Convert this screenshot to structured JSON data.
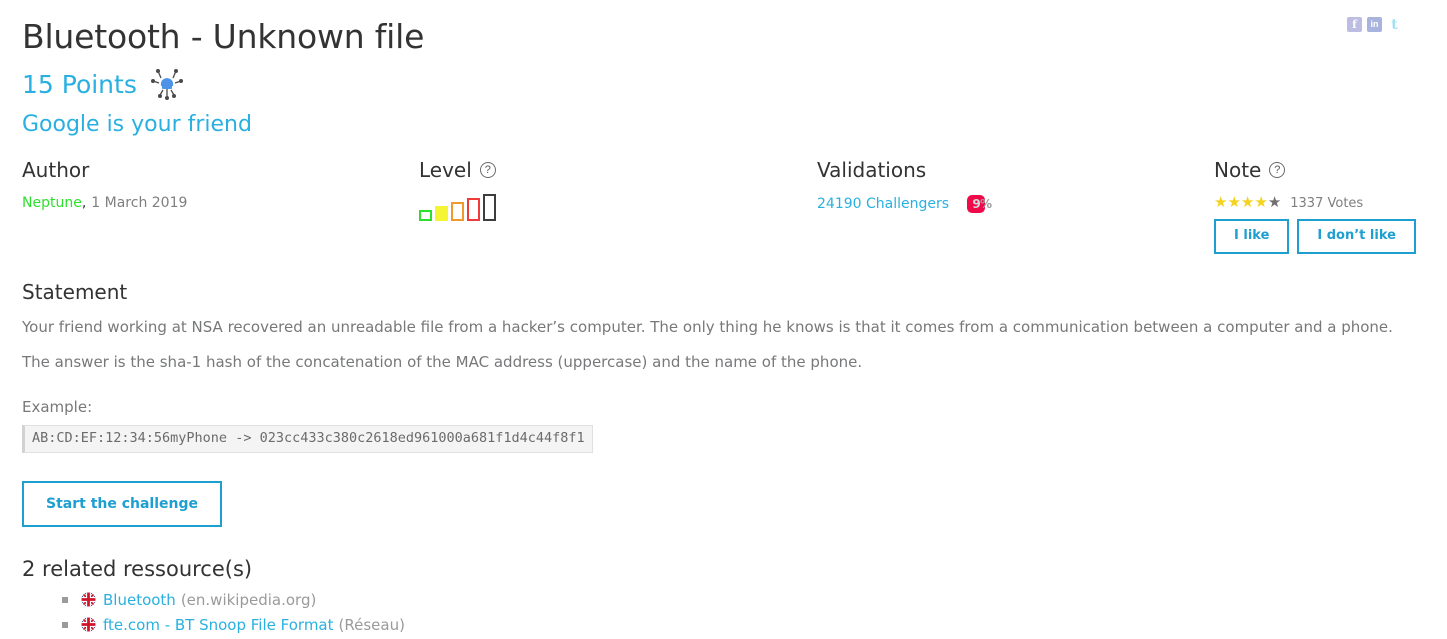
{
  "social": {
    "facebook": {
      "label": "f",
      "name": "facebook-share-icon",
      "color": "#bdbde4"
    },
    "linkedin": {
      "label": "in",
      "name": "linkedin-share-icon",
      "color": "#a8b4dd"
    },
    "twitter": {
      "label": "t",
      "name": "twitter-share-icon",
      "color": "#9fe0f3"
    }
  },
  "header": {
    "title": "Bluetooth - Unknown file",
    "points": "15 Points",
    "points_icon": "bug-icon",
    "subtitle": "Google is your friend"
  },
  "meta": {
    "author": {
      "heading": "Author",
      "name": "Neptune",
      "separator": ",",
      "date": "1 March 2019",
      "name_color": "#2ee02e"
    },
    "level": {
      "heading": "Level",
      "help_icon": "?",
      "bars": [
        {
          "color": "#2ee02e",
          "filled": false
        },
        {
          "color": "#f5f534",
          "filled": true
        },
        {
          "color": "#f09a2e",
          "filled": false
        },
        {
          "color": "#ef3b3b",
          "filled": false
        },
        {
          "color": "#3d3d3d",
          "filled": false
        }
      ]
    },
    "validations": {
      "heading": "Validations",
      "challengers": "24190 Challengers",
      "percent_value": "9",
      "percent_sign": "%",
      "badge_color": "#ef0a4a"
    },
    "note": {
      "heading": "Note",
      "help_icon": "?",
      "stars_filled": 4,
      "stars_total": 5,
      "votes": "1337 Votes",
      "like_label": "I like",
      "dislike_label": "I don’t like",
      "accent_color": "#1e9fd0"
    }
  },
  "statement": {
    "heading": "Statement",
    "paragraph1": "Your friend working at NSA recovered an unreadable file from a hacker’s computer. The only thing he knows is that it comes from a communication between a computer and a phone.",
    "paragraph2": "The answer is the sha-1 hash of the concatenation of the MAC address (uppercase) and the name of the phone.",
    "example_label": "Example:",
    "example_code": "AB:CD:EF:12:34:56myPhone -> 023cc433c380c2618ed961000a681f1d4c44f8f1",
    "start_button": "Start the challenge"
  },
  "resources": {
    "heading": "2 related ressource(s)",
    "items": [
      {
        "flag": "uk-flag-icon",
        "link": "Bluetooth",
        "source": "(en.wikipedia.org)"
      },
      {
        "flag": "uk-flag-icon",
        "link": "fte.com - BT Snoop File Format",
        "source": "(Réseau)"
      }
    ]
  }
}
